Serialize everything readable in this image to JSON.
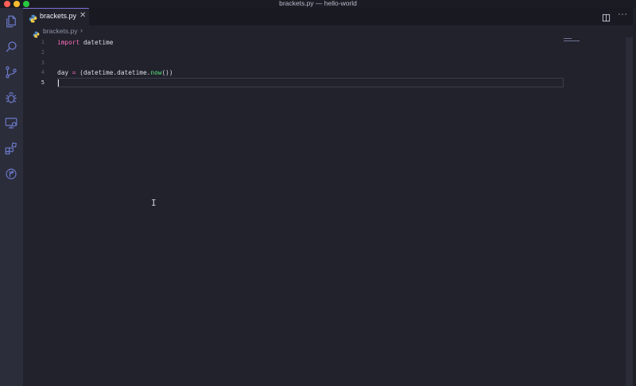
{
  "window": {
    "title": "brackets.py — hello-world"
  },
  "traffic_lights": {
    "close": "#ff5f57",
    "minimize": "#febc2e",
    "zoom": "#28c840"
  },
  "activity_bar": {
    "items": [
      {
        "name": "explorer",
        "icon": "files-icon"
      },
      {
        "name": "search",
        "icon": "search-icon"
      },
      {
        "name": "source-control",
        "icon": "git-branch-icon"
      },
      {
        "name": "debug",
        "icon": "bug-icon"
      },
      {
        "name": "remote-explorer",
        "icon": "remote-monitor-icon"
      },
      {
        "name": "extensions",
        "icon": "extensions-icon"
      },
      {
        "name": "gitlens",
        "icon": "gitlens-icon"
      }
    ],
    "icon_color": "#6b78c8"
  },
  "tab": {
    "label": "brackets.py",
    "close": "✕",
    "icon": "python-icon"
  },
  "tab_actions": {
    "split": "split-editor-icon",
    "more": "···"
  },
  "breadcrumb": {
    "file": "brackets.py",
    "chevron": "›"
  },
  "editor": {
    "lines": [
      {
        "n": "1",
        "active": false
      },
      {
        "n": "2",
        "active": false
      },
      {
        "n": "3",
        "active": false
      },
      {
        "n": "4",
        "active": false
      },
      {
        "n": "5",
        "active": true
      }
    ],
    "line1": {
      "kw": "import",
      "rest": " datetime"
    },
    "line4": {
      "a": "day ",
      "op": "=",
      "b": " (datetime.datetime.",
      "fn": "now",
      "c": "())"
    },
    "ibeam": "I"
  },
  "colors": {
    "keyword": "#ff6fbf",
    "function": "#5ae37b",
    "accent": "#7b6fd6"
  }
}
